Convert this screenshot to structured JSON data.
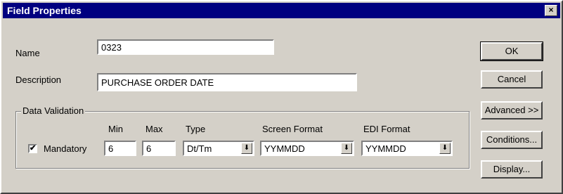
{
  "window": {
    "title": "Field Properties",
    "close_glyph": "×"
  },
  "form": {
    "name_label": "Name",
    "name_value": "0323",
    "description_label": "Description",
    "description_value": "PURCHASE ORDER DATE"
  },
  "validation": {
    "group_label": "Data Validation",
    "mandatory_label": "Mandatory",
    "mandatory_checked": true,
    "min_label": "Min",
    "min_value": "6",
    "max_label": "Max",
    "max_value": "6",
    "type_label": "Type",
    "type_value": "Dt/Tm",
    "screen_format_label": "Screen Format",
    "screen_format_value": "YYMMDD",
    "edi_format_label": "EDI Format",
    "edi_format_value": "YYMMDD"
  },
  "buttons": {
    "ok": "OK",
    "cancel": "Cancel",
    "advanced": "Advanced >>",
    "conditions": "Conditions...",
    "display": "Display..."
  },
  "icons": {
    "checkbox_mark": "✔",
    "dropdown_arrow": "⬇"
  },
  "colors": {
    "titlebar": "#000080",
    "face": "#d4d0c8"
  }
}
